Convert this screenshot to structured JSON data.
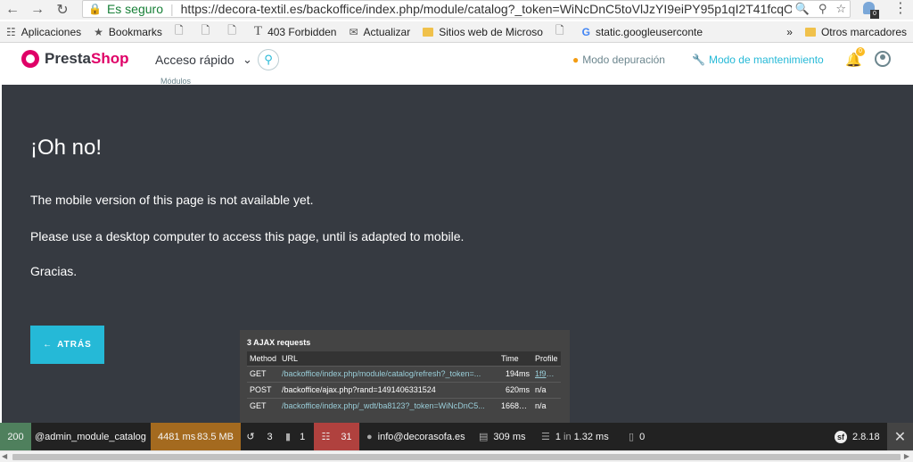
{
  "browser": {
    "secure_label": "Es seguro",
    "url": "https://decora-textil.es/backoffice/index.php/module/catalog?_token=WiNcDnC5toVlJzYI9eiPY95p1qI2T41fcqO",
    "extension_badge": "0"
  },
  "bookmarks": {
    "items": [
      {
        "label": "Aplicaciones",
        "icon": "apps-grid-icon"
      },
      {
        "label": "Bookmarks",
        "icon": "star-icon"
      },
      {
        "label": "",
        "icon": "page-icon"
      },
      {
        "label": "",
        "icon": "page-icon"
      },
      {
        "label": "",
        "icon": "page-icon"
      },
      {
        "label": "403 Forbidden",
        "icon": "font-icon"
      },
      {
        "label": "Actualizar",
        "icon": "mail-icon"
      },
      {
        "label": "Sitios web de Microso",
        "icon": "folder-icon"
      },
      {
        "label": "",
        "icon": "page-icon"
      },
      {
        "label": "static.googleuserconte",
        "icon": "google-icon"
      }
    ],
    "overflow": "»",
    "other_label": "Otros marcadores"
  },
  "header": {
    "logo_presta": "Presta",
    "logo_shop": "Shop",
    "quick_access": "Acceso rápido",
    "submenu_peek": "Módulos",
    "debug_mode": "Modo depuración",
    "maintenance_mode": "Modo de mantenimiento",
    "notifications_count": "0"
  },
  "main": {
    "title": "¡Oh no!",
    "message1": "The mobile version of this page is not available yet.",
    "message2": "Please use a desktop computer to access this page, until is adapted to mobile.",
    "message3": "Gracias.",
    "back_button": "ATRÁS"
  },
  "ajax_panel": {
    "title": "3 AJAX requests",
    "headers": [
      "Method",
      "URL",
      "Time",
      "Profile"
    ],
    "rows": [
      {
        "method": "GET",
        "url": "/backoffice/index.php/module/catalog/refresh?_token=...",
        "time": "194ms",
        "profile": "1f9851"
      },
      {
        "method": "POST",
        "url": "/backoffice/ajax.php?rand=1491406331524",
        "time": "620ms",
        "profile": "n/a"
      },
      {
        "method": "GET",
        "url": "/backoffice/index.php/_wdt/ba8123?_token=WiNcDnC5...",
        "time": "1668ms",
        "profile": "n/a"
      }
    ]
  },
  "toolbar": {
    "status": "200",
    "route": "@admin_module_catalog",
    "time": "4481 ms",
    "memory": "83.5 MB",
    "ajax_count": "3",
    "forms": "1",
    "translations": "31",
    "user": "info@decorasofa.es",
    "db_queries": "309 ms",
    "cache_calls": "1",
    "cache_in": "in",
    "cache_time": "1.32 ms",
    "dump_count": "0",
    "version": "2.8.18",
    "colors": {
      "status": "#4f805d",
      "time": "#a46a1f",
      "error": "#b0413e"
    }
  }
}
